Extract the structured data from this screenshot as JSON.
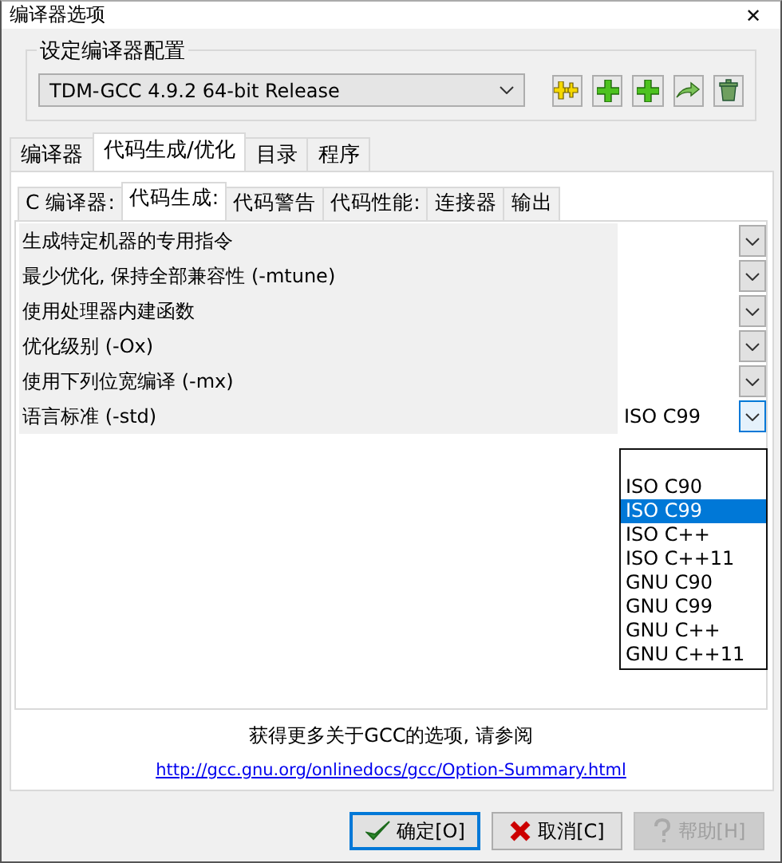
{
  "window": {
    "title": "编译器选项",
    "close": "✕"
  },
  "config_group": {
    "label": "设定编译器配置",
    "compiler": "TDM-GCC 4.9.2 64-bit Release"
  },
  "tabs": [
    {
      "label": "编译器",
      "selected": false
    },
    {
      "label": "代码生成/优化",
      "selected": true
    },
    {
      "label": "目录",
      "selected": false
    },
    {
      "label": "程序",
      "selected": false
    }
  ],
  "subtabs": [
    {
      "label": "C 编译器:",
      "selected": false
    },
    {
      "label": "代码生成:",
      "selected": true
    },
    {
      "label": "代码警告",
      "selected": false
    },
    {
      "label": "代码性能:",
      "selected": false
    },
    {
      "label": "连接器",
      "selected": false
    },
    {
      "label": "输出",
      "selected": false
    }
  ],
  "options": [
    {
      "label": "生成特定机器的专用指令",
      "open": false
    },
    {
      "label": "最少优化, 保持全部兼容性 (-mtune)",
      "open": false
    },
    {
      "label": "使用处理器内建函数",
      "open": false
    },
    {
      "label": "优化级别 (-Ox)",
      "open": false
    },
    {
      "label": "使用下列位宽编译 (-mx)",
      "open": false
    },
    {
      "label": "语言标准 (-std)",
      "value": "ISO C99",
      "open": true
    }
  ],
  "dropdown_items": [
    {
      "label": "ISO C90",
      "selected": false
    },
    {
      "label": "ISO C99",
      "selected": true
    },
    {
      "label": "ISO C++",
      "selected": false
    },
    {
      "label": "ISO C++11",
      "selected": false
    },
    {
      "label": "GNU C90",
      "selected": false
    },
    {
      "label": "GNU C99",
      "selected": false
    },
    {
      "label": "GNU C++",
      "selected": false
    },
    {
      "label": "GNU C++11",
      "selected": false
    }
  ],
  "info": "获得更多关于GCC的选项, 请参阅",
  "link": "http://gcc.gnu.org/onlinedocs/gcc/Option-Summary.html",
  "buttons": [
    {
      "kind": "ok",
      "label": "确定[O]",
      "disabled": false,
      "focused": true
    },
    {
      "kind": "cancel",
      "label": "取消[C]",
      "disabled": false,
      "focused": false
    },
    {
      "kind": "help",
      "label": "帮助[H]",
      "disabled": true,
      "focused": false
    }
  ]
}
